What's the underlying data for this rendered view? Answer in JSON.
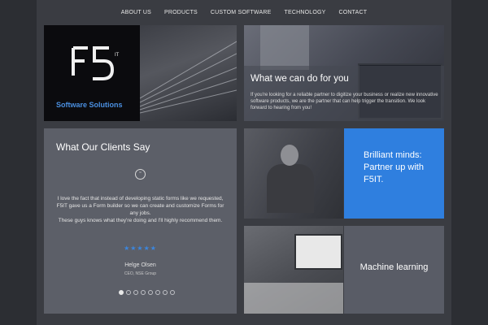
{
  "nav": {
    "items": [
      "ABOUT US",
      "PRODUCTS",
      "CUSTOM SOFTWARE",
      "TECHNOLOGY",
      "CONTACT"
    ]
  },
  "brand": {
    "logo_text": "F5",
    "logo_tag": "IT",
    "caption": "Software Solutions"
  },
  "services": {
    "title": "What we can do for you",
    "body": "If you're looking for a reliable partner to digitize your business or realize new innovative software products, we are the partner that can help trigger the transition. We look forward to hearing from you!"
  },
  "testimonials": {
    "title": "What Our Clients Say",
    "quote_icon": "quote-icon",
    "quote": "I love the fact that instead of developing static forms like we requested, F5IT gave us a Form builder so we can create and customize Forms for any jobs.\nThese guys knows what they're doing and I'll highly recommend them.",
    "rating": 5,
    "stars": "★★★★★",
    "author": "Helge Olsen",
    "role": "CEO, NSE Group",
    "slides_total": 8,
    "active_slide": 1
  },
  "brilliant": {
    "text": "Brilliant minds: Partner up with F5IT."
  },
  "ml": {
    "text": "Machine learning"
  },
  "colors": {
    "accent": "#2f7fdf",
    "page_bg": "#3a3c42",
    "body_bg": "#2c2e33"
  }
}
